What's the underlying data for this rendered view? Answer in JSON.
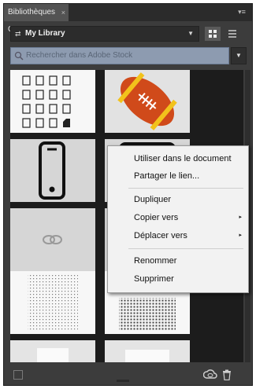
{
  "panel": {
    "tab_title": "Bibliothèques CC",
    "tab_close": "×",
    "menu_icon": "panel-menu-icon",
    "library": {
      "name": "My Library",
      "icon": "library-icon",
      "caret": "▼"
    },
    "view_modes": [
      "grid-view-icon",
      "list-view-icon"
    ],
    "search": {
      "placeholder": "Rechercher dans Adobe Stock",
      "dropdown": "▼"
    }
  },
  "context_menu": {
    "items": [
      {
        "label": "Utiliser dans le document",
        "submenu": false
      },
      {
        "label": "Partager le lien...",
        "submenu": false
      },
      {
        "label": "Dupliquer",
        "submenu": false
      },
      {
        "label": "Copier vers",
        "submenu": true
      },
      {
        "label": "Déplacer vers",
        "submenu": true
      },
      {
        "label": "Renommer",
        "submenu": false
      },
      {
        "label": "Supprimer",
        "submenu": false
      }
    ],
    "submenu_arrow": "▸"
  },
  "footer": {
    "icons": [
      "checkbox-icon",
      "creative-cloud-icon",
      "trash-icon"
    ]
  },
  "colors": {
    "panel_bg": "#3c3c3c",
    "search_bg": "#8d9bb0",
    "menu_bg": "#f2f2f2",
    "football": "#d04a1a",
    "stripe": "#f2c21b"
  }
}
